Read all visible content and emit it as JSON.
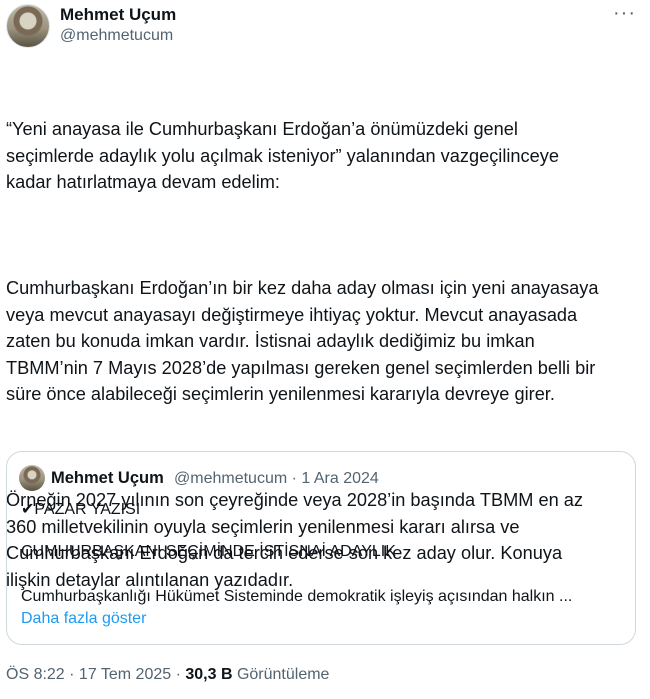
{
  "author": {
    "name": "Mehmet Uçum",
    "handle": "@mehmetucum"
  },
  "menu_glyph": "···",
  "tweet": {
    "paragraphs": [
      "“Yeni anayasa ile Cumhurbaşkanı Erdoğan’a önümüzdeki genel\nseçimlerde adaylık yolu açılmak isteniyor” yalanından vazgeçilinceye\nkadar hatırlatmaya devam edelim:",
      "Cumhurbaşkanı Erdoğan’ın bir kez daha aday olması için yeni anayasaya\nveya mevcut anayasayı değiştirmeye ihtiyaç yoktur. Mevcut anayasada\nzaten bu konuda imkan vardır. İstisnai adaylık dediğimiz bu imkan\nTBMM’nin 7 Mayıs 2028’de yapılması gereken genel seçimlerden belli bir\nsüre önce alabileceği seçimlerin yenilenmesi kararıyla devreye girer.",
      "Örneğin 2027 yılının son çeyreğinde veya 2028’in başında TBMM en az\n360 milletvekilinin oyuyla seçimlerin yenilenmesi kararı alırsa ve\nCumhurbaşkanı Erdoğan da tercih ederse son kez aday olur. Konuya\nilişkin detaylar alıntılanan yazıdadır."
    ]
  },
  "quote": {
    "name": "Mehmet Uçum",
    "meta": "@mehmetucum · 1 Ara 2024",
    "line1": "✔PAZAR YAZISI",
    "line2": "CUMHURBAŞKANI SEÇİMİNDE İSTİSNAİ ADAYLIK",
    "line3": "Cumhurbaşkanlığı Hükümet Sisteminde demokratik işleyiş açısından halkın ...",
    "show_more": "Daha fazla göster"
  },
  "footer": {
    "time_date": "ÖS 8:22 · 17 Tem 2025 · ",
    "views_count": "30,3 B",
    "views_label": " Görüntüleme"
  }
}
